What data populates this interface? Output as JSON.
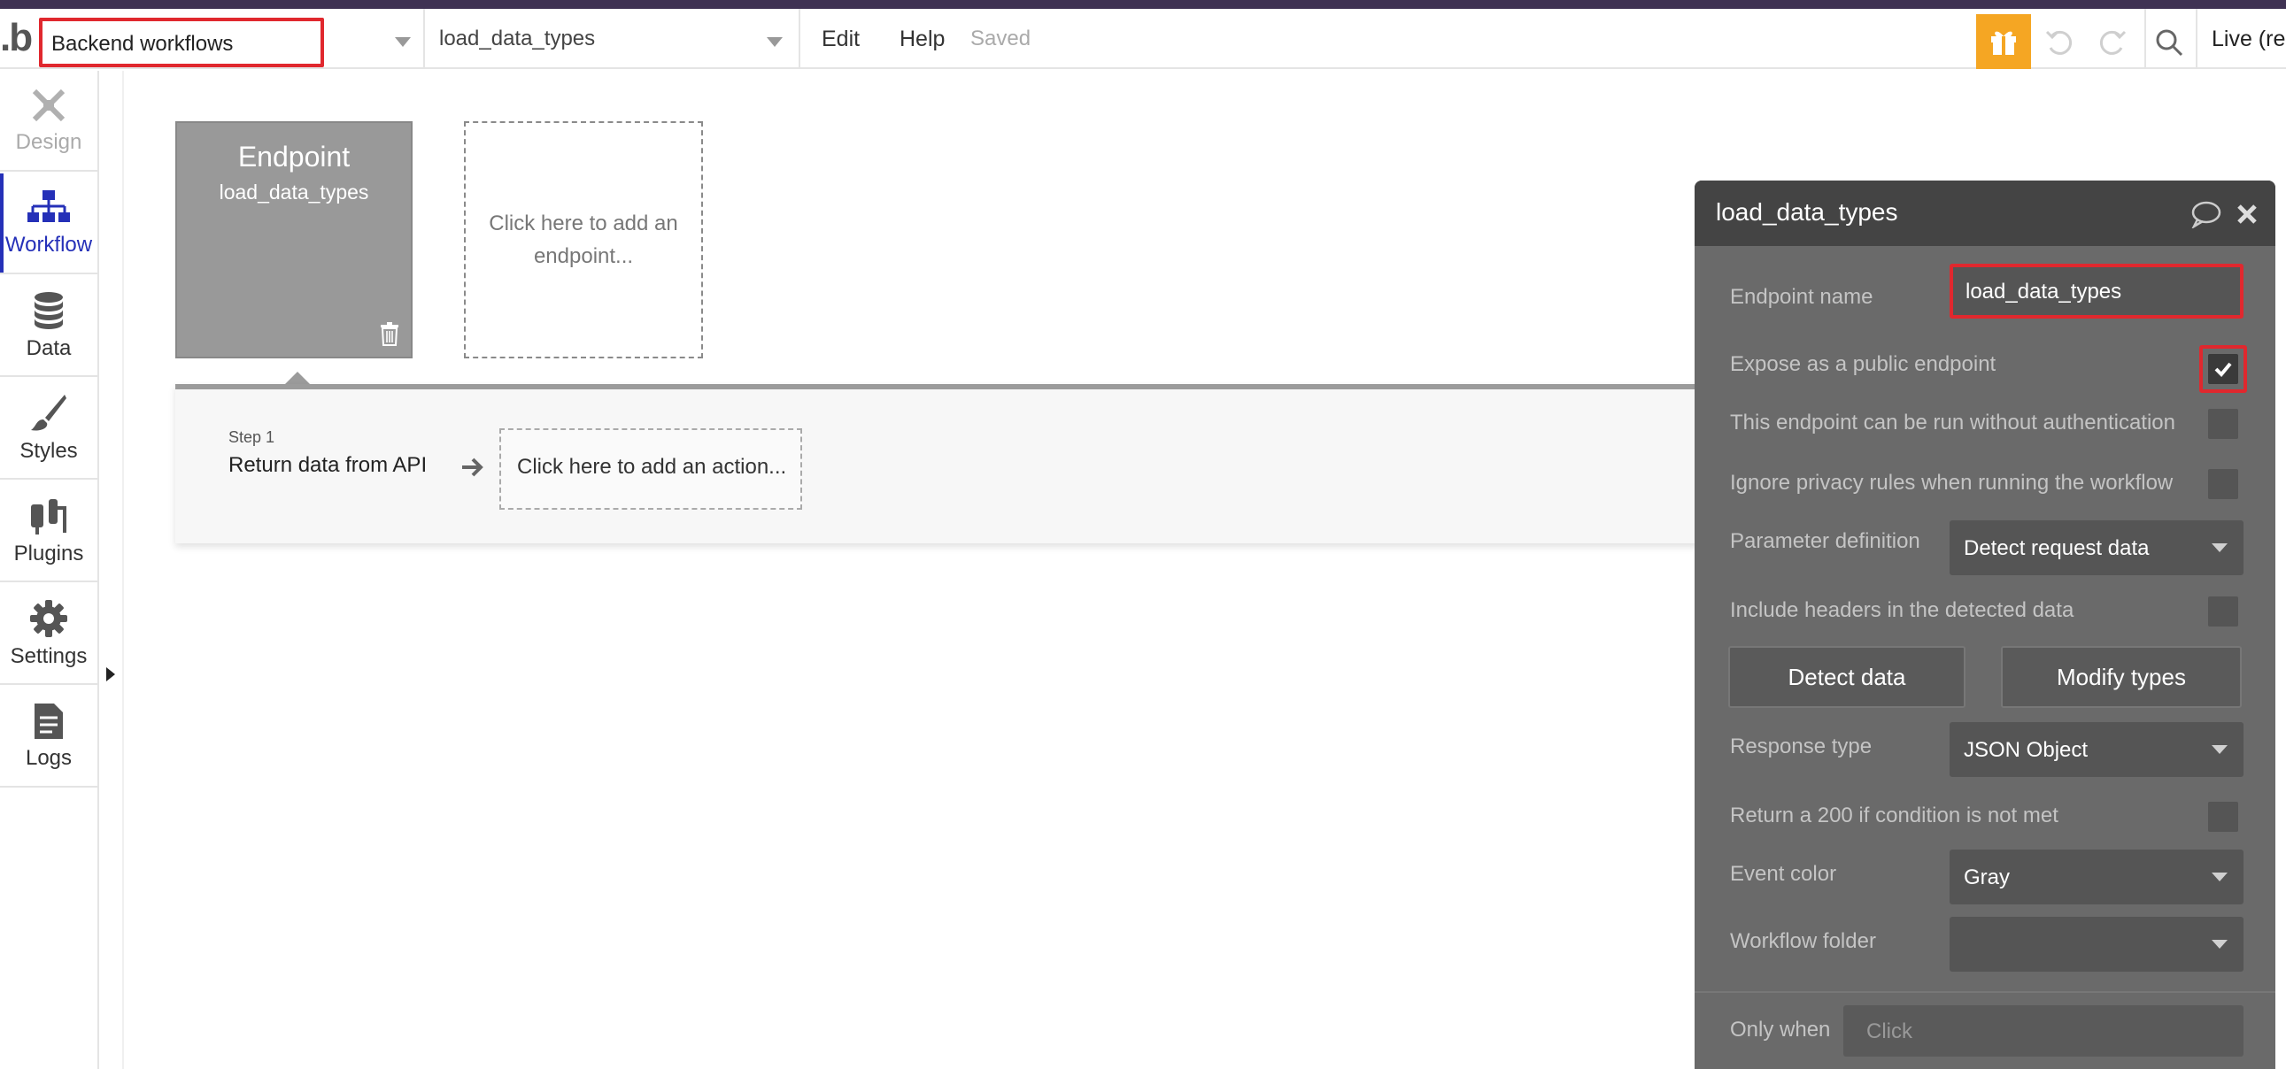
{
  "topbar": {
    "logo": ".b",
    "page_selector": "Backend workflows",
    "workflow_selector": "load_data_types",
    "menu": {
      "edit": "Edit",
      "help": "Help"
    },
    "status": "Saved",
    "live_label": "Live (rea"
  },
  "sidebar": {
    "items": [
      {
        "label": "Design",
        "icon": "design-icon",
        "state": "disabled"
      },
      {
        "label": "Workflow",
        "icon": "workflow-icon",
        "state": "active"
      },
      {
        "label": "Data",
        "icon": "database-icon",
        "state": "normal"
      },
      {
        "label": "Styles",
        "icon": "brush-icon",
        "state": "normal"
      },
      {
        "label": "Plugins",
        "icon": "plug-icon",
        "state": "normal"
      },
      {
        "label": "Settings",
        "icon": "gear-icon",
        "state": "normal"
      },
      {
        "label": "Logs",
        "icon": "document-icon",
        "state": "normal"
      }
    ]
  },
  "canvas": {
    "endpoint_card": {
      "title": "Endpoint",
      "name": "load_data_types"
    },
    "add_endpoint": "Click here to add an endpoint...",
    "step": {
      "label": "Step 1",
      "name": "Return data from API"
    },
    "add_action": "Click here to add an action..."
  },
  "panel": {
    "title": "load_data_types",
    "endpoint_name_label": "Endpoint name",
    "endpoint_name_value": "load_data_types",
    "expose_public_label": "Expose as a public endpoint",
    "expose_public_checked": true,
    "no_auth_label": "This endpoint can be run without authentication",
    "ignore_privacy_label": "Ignore privacy rules when running the workflow",
    "param_def_label": "Parameter definition",
    "param_def_value": "Detect request data",
    "include_headers_label": "Include headers in the detected data",
    "detect_data_button": "Detect data",
    "modify_types_button": "Modify types",
    "response_type_label": "Response type",
    "response_type_value": "JSON Object",
    "return_200_label": "Return a 200 if condition is not met",
    "event_color_label": "Event color",
    "event_color_value": "Gray",
    "workflow_folder_label": "Workflow folder",
    "workflow_folder_value": "",
    "only_when_label": "Only when",
    "only_when_placeholder": "Click"
  },
  "colors": {
    "accent": "#2530b8",
    "highlight": "#e0282e",
    "gift": "#f5a623",
    "panel_bg": "#6a6a6a",
    "panel_header": "#444444",
    "endpoint_card": "#999999"
  }
}
